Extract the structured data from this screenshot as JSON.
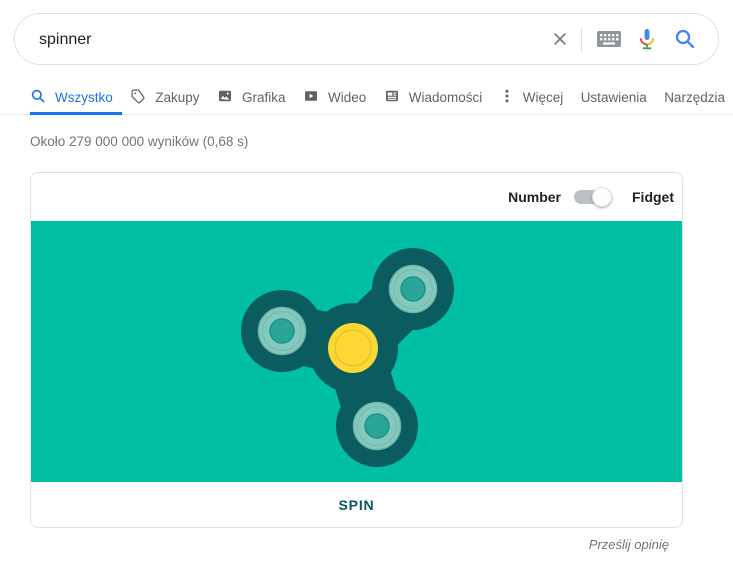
{
  "colors": {
    "accent-blue": "#1a73e8",
    "teal-bg": "#00bfa5",
    "spinner-body": "#0a5c5f",
    "bearing-outer": "#85c9be",
    "bearing-outer-ring": "#6db3a8",
    "bearing-inner": "#2aa496",
    "bearing-inner-ring": "#1d9386",
    "hub-yellow": "#fdd835",
    "hub-ring": "#ecc52f",
    "spin-text": "#07585c"
  },
  "search": {
    "query": "spinner",
    "icons": [
      "clear-icon",
      "keyboard-icon",
      "mic-icon",
      "search-icon"
    ]
  },
  "tabs": [
    {
      "label": "Wszystko",
      "icon": "search-icon",
      "active": true
    },
    {
      "label": "Zakupy",
      "icon": "shopping-tag-icon"
    },
    {
      "label": "Grafika",
      "icon": "image-icon"
    },
    {
      "label": "Wideo",
      "icon": "video-icon"
    },
    {
      "label": "Wiadomości",
      "icon": "news-icon"
    },
    {
      "label": "Więcej",
      "icon": "more-vert-icon"
    },
    {
      "label": "Ustawienia"
    },
    {
      "label": "Narzędzia"
    }
  ],
  "stats": "Około 279 000 000 wyników (0,68 s)",
  "widget": {
    "toggle": {
      "left": "Number",
      "right": "Fidget",
      "selected": "Fidget"
    },
    "spin": "SPIN"
  },
  "feedback": "Prześlij opinię"
}
